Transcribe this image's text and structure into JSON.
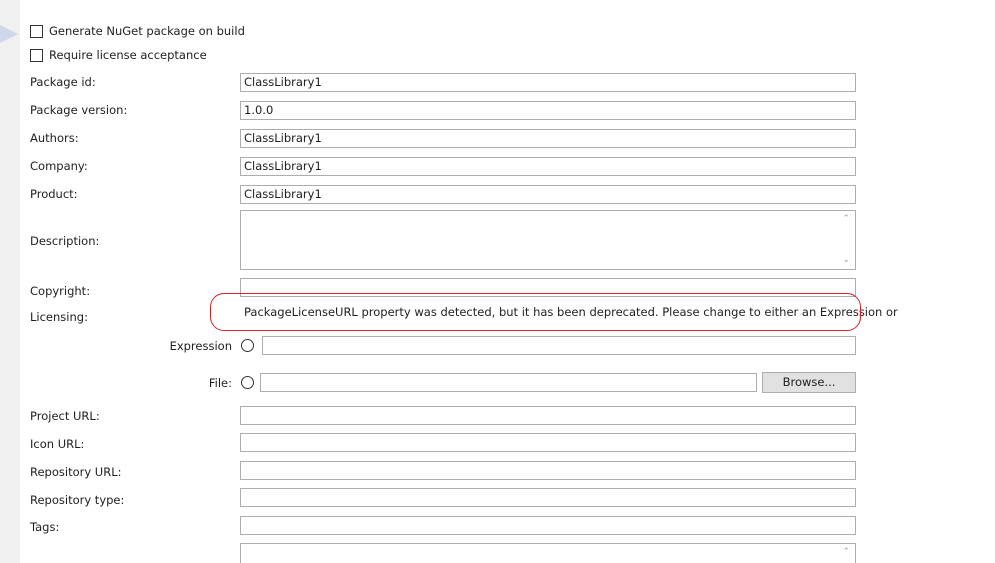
{
  "options": {
    "generate_nuget": "Generate NuGet package on build",
    "require_license": "Require license acceptance"
  },
  "fields": {
    "package_id": {
      "label": "Package id:",
      "value": "ClassLibrary1"
    },
    "package_version": {
      "label": "Package version:",
      "value": "1.0.0"
    },
    "authors": {
      "label": "Authors:",
      "value": "ClassLibrary1"
    },
    "company": {
      "label": "Company:",
      "value": "ClassLibrary1"
    },
    "product": {
      "label": "Product:",
      "value": "ClassLibrary1"
    },
    "description": {
      "label": "Description:",
      "value": ""
    },
    "copyright": {
      "label": "Copyright:",
      "value": ""
    },
    "licensing": {
      "label": "Licensing:"
    },
    "project_url": {
      "label": "Project URL:",
      "value": ""
    },
    "icon_url": {
      "label": "Icon URL:",
      "value": ""
    },
    "repository_url": {
      "label": "Repository URL:",
      "value": ""
    },
    "repository_type": {
      "label": "Repository type:",
      "value": ""
    },
    "tags": {
      "label": "Tags:",
      "value": ""
    }
  },
  "licensing": {
    "warning": "PackageLicenseURL property was detected, but it has been deprecated. Please change to either an Expression or",
    "expression_label": "Expression",
    "expression_value": "",
    "file_label": "File:",
    "file_value": "",
    "browse_label": "Browse..."
  },
  "colors": {
    "highlight_border": "#d0202a",
    "panel_bg": "#ffffff",
    "side_bg": "#f0f0f0"
  }
}
